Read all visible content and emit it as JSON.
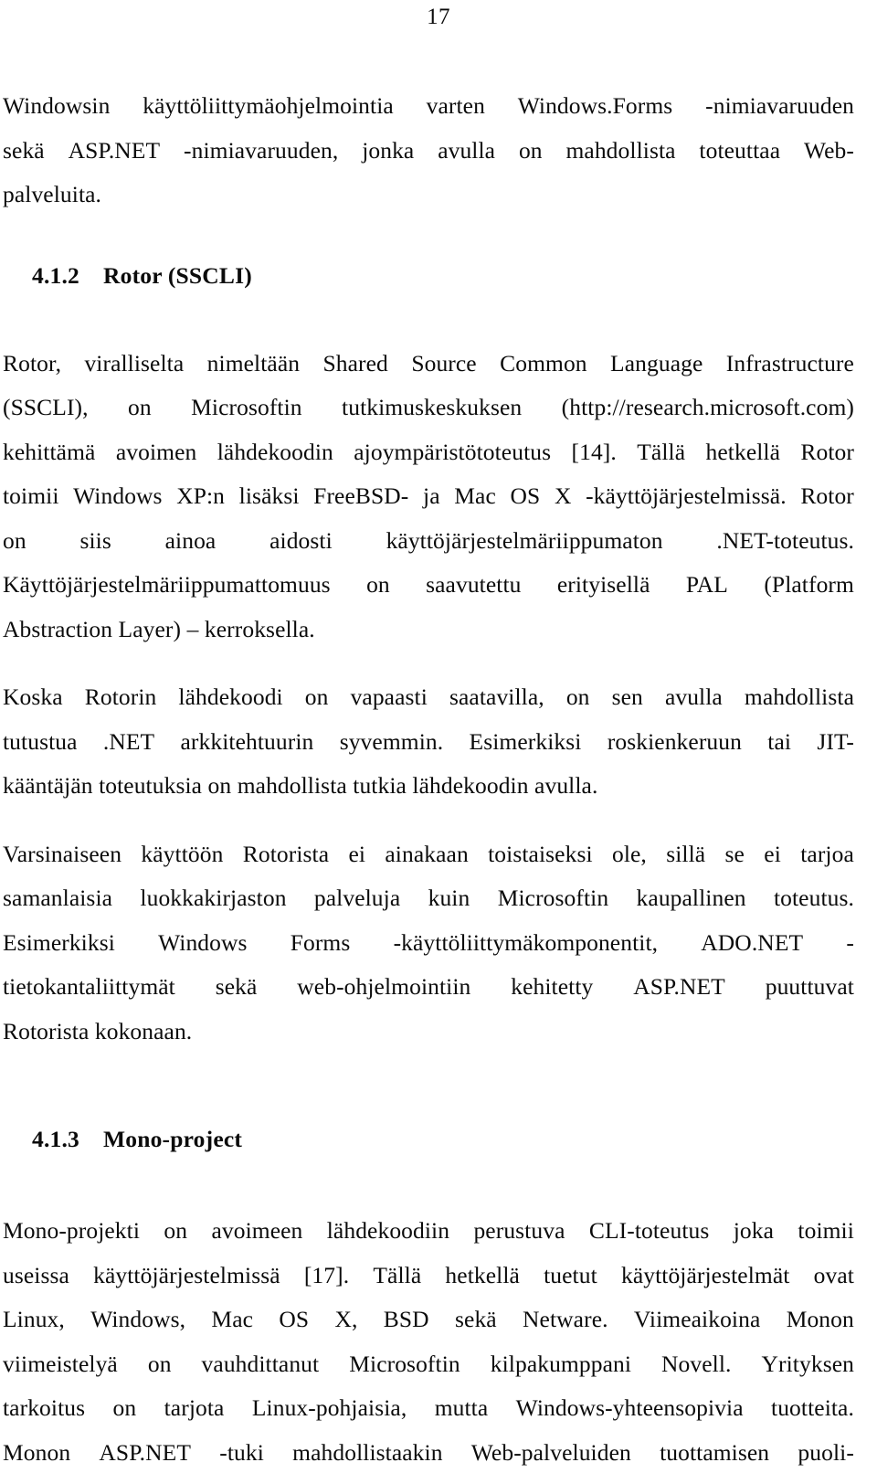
{
  "page": {
    "number": "17"
  },
  "blocks": [
    {
      "id": "intro_paragraph",
      "lines": [
        "Windowsin käyttöliittymäohjelmointia varten Windows.Forms -nimiavaruuden",
        "sekä ASP.NET -nimiavaruuden, jonka avulla on mahdollista toteuttaa Web-",
        "palveluita."
      ]
    },
    {
      "id": "heading_412",
      "number": "4.1.2",
      "title": "Rotor (SSCLI)"
    },
    {
      "id": "rotor_paragraph_1",
      "lines": [
        "Rotor, viralliselta nimeltään Shared Source Common Language Infrastructure",
        "(SSCLI), on Microsoftin tutkimuskeskuksen (http://research.microsoft.com)",
        "kehittämä avoimen lähdekoodin ajoympäristötoteutus [14]. Tällä hetkellä Rotor",
        "toimii Windows XP:n lisäksi FreeBSD- ja Mac OS X -käyttöjärjestelmissä. Rotor",
        "on siis ainoa aidosti käyttöjärjestelmäriippumaton .NET-toteutus.",
        "Käyttöjärjestelmäriippumattomuus on saavutettu erityisellä PAL (Platform",
        "Abstraction Layer) – kerroksella."
      ]
    },
    {
      "id": "rotor_paragraph_2",
      "lines": [
        "Koska Rotorin lähdekoodi on vapaasti saatavilla, on sen avulla mahdollista",
        "tutustua .NET arkkitehtuurin syvemmin. Esimerkiksi roskienkeruun tai JIT-",
        "kääntäjän toteutuksia on mahdollista tutkia lähdekoodin avulla."
      ]
    },
    {
      "id": "rotor_paragraph_3",
      "lines": [
        "Varsinaiseen käyttöön Rotorista ei ainakaan toistaiseksi ole, sillä se ei tarjoa",
        "samanlaisia luokkakirjaston palveluja kuin Microsoftin kaupallinen toteutus.",
        "Esimerkiksi Windows Forms -käyttöliittymäkomponentit, ADO.NET -",
        "tietokantaliittymät sekä web-ohjelmointiin kehitetty ASP.NET puuttuvat",
        "Rotorista kokonaan."
      ]
    },
    {
      "id": "heading_413",
      "number": "4.1.3",
      "title": "Mono-project"
    },
    {
      "id": "mono_paragraph",
      "lines": [
        "Mono-projekti on avoimeen lähdekoodiin perustuva CLI-toteutus joka toimii",
        "useissa käyttöjärjestelmissä [17]. Tällä hetkellä tuetut käyttöjärjestelmät ovat",
        "Linux, Windows, Mac OS X, BSD sekä Netware. Viimeaikoina Monon",
        "viimeistelyä on vauhdittanut Microsoftin kilpakumppani Novell. Yrityksen",
        "tarkoitus on tarjota Linux-pohjaisia, mutta Windows-yhteensopivia tuotteita.",
        "Monon ASP.NET -tuki mahdollistaakin Web-palveluiden tuottamisen puoli-"
      ]
    }
  ]
}
